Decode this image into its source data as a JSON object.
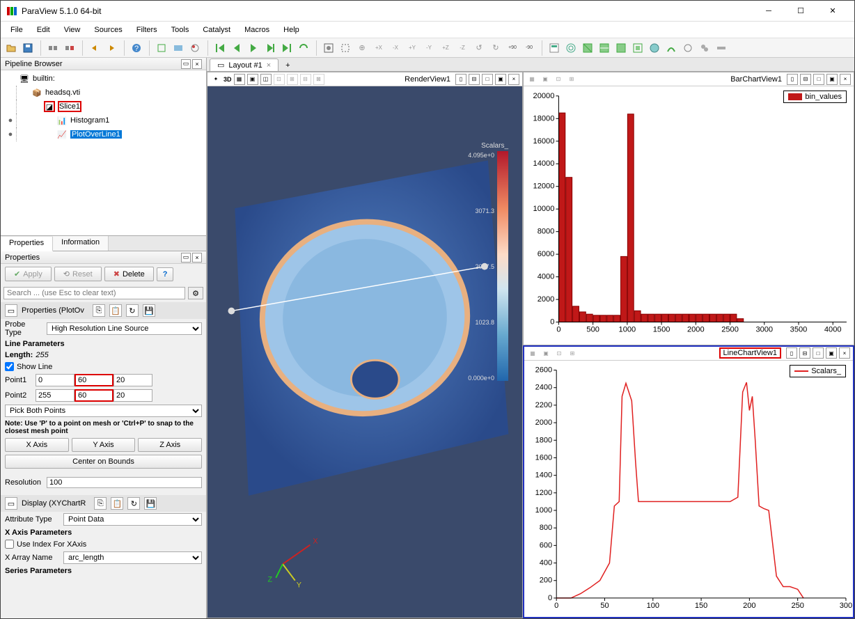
{
  "app": {
    "title": "ParaView 5.1.0 64-bit"
  },
  "menubar": [
    "File",
    "Edit",
    "View",
    "Sources",
    "Filters",
    "Tools",
    "Catalyst",
    "Macros",
    "Help"
  ],
  "pipeline": {
    "title": "Pipeline Browser",
    "items": [
      {
        "label": "builtin:",
        "icon": "server",
        "indent": 0,
        "eye": ""
      },
      {
        "label": "headsq.vti",
        "icon": "data",
        "indent": 1,
        "eye": ""
      },
      {
        "label": "Slice1",
        "icon": "slice",
        "indent": 2,
        "eye": "",
        "highlight": true
      },
      {
        "label": "Histogram1",
        "icon": "hist",
        "indent": 3,
        "eye": "●"
      },
      {
        "label": "PlotOverLine1",
        "icon": "plot",
        "indent": 3,
        "eye": "●",
        "selected": true
      }
    ]
  },
  "props_tabs": [
    "Properties",
    "Information"
  ],
  "props": {
    "title": "Properties",
    "apply": "Apply",
    "reset": "Reset",
    "delete": "Delete",
    "help": "?",
    "search_placeholder": "Search ... (use Esc to clear text)",
    "section1": "Properties (PlotOv",
    "probe_type_label": "Probe Type",
    "probe_type": "High Resolution Line Source",
    "line_params": "Line Parameters",
    "length_label": "Length:",
    "length": "255",
    "show_line": "Show Line",
    "point1_label": "Point1",
    "p1": [
      "0",
      "60",
      "20"
    ],
    "point2_label": "Point2",
    "p2": [
      "255",
      "60",
      "20"
    ],
    "pick_both": "Pick Both Points",
    "note": "Note: Use 'P' to a point on mesh or 'Ctrl+P' to snap to the closest mesh point",
    "xaxis": "X Axis",
    "yaxis": "Y Axis",
    "zaxis": "Z Axis",
    "center": "Center on Bounds",
    "resolution_label": "Resolution",
    "resolution": "100",
    "section2": "Display (XYChartR",
    "attr_type_label": "Attribute Type",
    "attr_type": "Point Data",
    "xaxis_params": "X Axis Parameters",
    "use_index": "Use Index For XAxis",
    "xarray_label": "X Array Name",
    "xarray": "arc_length",
    "series_params": "Series Parameters"
  },
  "layout": {
    "tab": "Layout #1"
  },
  "views": {
    "render": {
      "label": "RenderView1",
      "colorbar_label": "Scalars_",
      "ticks": [
        "4.095e+0",
        "3071.3",
        "2047.5",
        "1023.8",
        "0.000e+0"
      ]
    },
    "bar": {
      "label": "BarChartView1",
      "legend": "bin_values"
    },
    "line": {
      "label": "LineChartView1",
      "legend": "Scalars_",
      "highlight": true
    }
  },
  "chart_data": [
    {
      "type": "bar",
      "title": "",
      "xlabel": "",
      "ylabel": "",
      "xlim": [
        0,
        4200
      ],
      "ylim": [
        0,
        20000
      ],
      "categories": [
        50,
        150,
        250,
        350,
        450,
        550,
        650,
        750,
        850,
        950,
        1050,
        1150,
        1250,
        1350,
        1450,
        1550,
        1650,
        1750,
        1850,
        1950,
        2050,
        2150,
        2250,
        2350,
        2450,
        2550,
        2650
      ],
      "values": [
        18500,
        12800,
        1400,
        900,
        700,
        600,
        600,
        600,
        600,
        5800,
        18400,
        1000,
        700,
        700,
        700,
        700,
        700,
        700,
        700,
        700,
        700,
        700,
        700,
        700,
        700,
        700,
        300
      ],
      "legend": "bin_values",
      "color": "#c01818"
    },
    {
      "type": "line",
      "title": "",
      "xlabel": "",
      "ylabel": "",
      "xlim": [
        0,
        300
      ],
      "ylim": [
        0,
        2600
      ],
      "series": [
        {
          "name": "Scalars_",
          "color": "#e02020",
          "x": [
            0,
            15,
            25,
            35,
            45,
            55,
            60,
            65,
            68,
            72,
            78,
            82,
            85,
            90,
            100,
            110,
            120,
            130,
            140,
            150,
            160,
            170,
            180,
            188,
            193,
            197,
            200,
            203,
            206,
            210,
            215,
            220,
            228,
            235,
            242,
            250,
            256
          ],
          "y": [
            0,
            0,
            50,
            120,
            200,
            400,
            1050,
            1100,
            2300,
            2450,
            2250,
            1550,
            1100,
            1100,
            1100,
            1100,
            1100,
            1100,
            1100,
            1100,
            1100,
            1100,
            1100,
            1150,
            2350,
            2460,
            2140,
            2300,
            1800,
            1050,
            1020,
            1000,
            250,
            130,
            130,
            100,
            0
          ]
        }
      ]
    }
  ]
}
